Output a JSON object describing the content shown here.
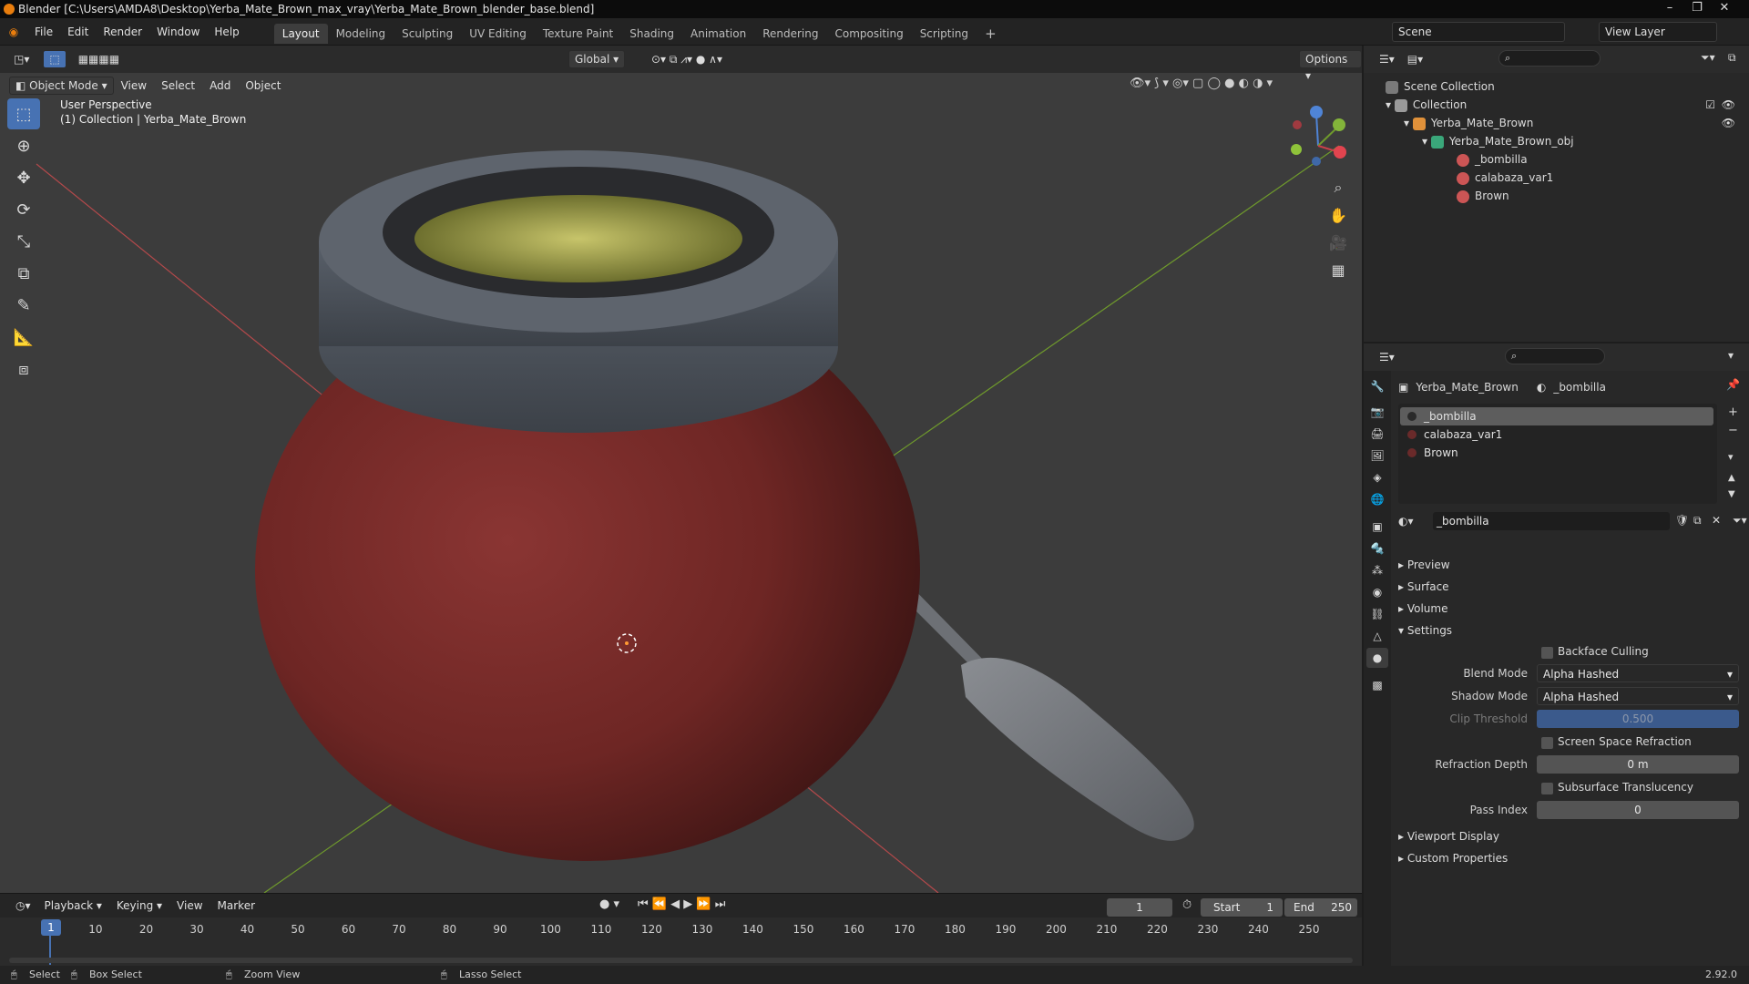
{
  "titlebar": {
    "title": "Blender [C:\\Users\\AMDA8\\Desktop\\Yerba_Mate_Brown_max_vray\\Yerba_Mate_Brown_blender_base.blend]"
  },
  "menu": [
    "File",
    "Edit",
    "Render",
    "Window",
    "Help"
  ],
  "workspaces": [
    "Layout",
    "Modeling",
    "Sculpting",
    "UV Editing",
    "Texture Paint",
    "Shading",
    "Animation",
    "Rendering",
    "Compositing",
    "Scripting"
  ],
  "scene": {
    "scene_name": "Scene",
    "view_layer": "View Layer"
  },
  "viewport": {
    "transform": "Global",
    "options": "Options",
    "mode": "Object Mode",
    "header_menus": [
      "View",
      "Select",
      "Add",
      "Object"
    ],
    "perspective": "User Perspective",
    "collection_info": "(1) Collection | Yerba_Mate_Brown",
    "gizmo": {
      "z": "Z",
      "y": "Y",
      "x": "X"
    }
  },
  "outliner": {
    "rows": [
      {
        "label": "Scene Collection"
      },
      {
        "label": "Collection"
      },
      {
        "label": "Yerba_Mate_Brown"
      },
      {
        "label": "Yerba_Mate_Brown_obj"
      },
      {
        "label": "_bombilla"
      },
      {
        "label": "calabaza_var1"
      },
      {
        "label": "Brown"
      }
    ]
  },
  "properties": {
    "object_name": "Yerba_Mate_Brown",
    "material_name": "_bombilla",
    "slots": [
      "_bombilla",
      "calabaza_var1",
      "Brown"
    ],
    "active_material": "_bombilla",
    "sections": {
      "preview": "Preview",
      "surface": "Surface",
      "volume": "Volume",
      "settings": "Settings",
      "viewport_display": "Viewport Display",
      "custom_properties": "Custom Properties"
    },
    "settings": {
      "backface_culling": "Backface Culling",
      "blend_mode_label": "Blend Mode",
      "blend_mode": "Alpha Hashed",
      "shadow_mode_label": "Shadow Mode",
      "shadow_mode": "Alpha Hashed",
      "clip_threshold_label": "Clip Threshold",
      "clip_threshold": "0.500",
      "ssr": "Screen Space Refraction",
      "refraction_depth_label": "Refraction Depth",
      "refraction_depth": "0 m",
      "subsurface": "Subsurface Translucency",
      "pass_index_label": "Pass Index",
      "pass_index": "0"
    }
  },
  "timeline": {
    "menus": [
      "Playback",
      "Keying",
      "View",
      "Marker"
    ],
    "current_frame": "1",
    "start_label": "Start",
    "start": "1",
    "end_label": "End",
    "end": "250",
    "ticks": [
      "1",
      "10",
      "20",
      "30",
      "40",
      "50",
      "60",
      "70",
      "80",
      "90",
      "100",
      "110",
      "120",
      "130",
      "140",
      "150",
      "160",
      "170",
      "180",
      "190",
      "200",
      "210",
      "220",
      "230",
      "240",
      "250"
    ]
  },
  "statusbar": {
    "select": "Select",
    "box_select": "Box Select",
    "zoom_view": "Zoom View",
    "lasso_select": "Lasso Select",
    "version": "2.92.0"
  },
  "colors": {
    "accent": "#4772b3",
    "gourd": "#7a2b2a",
    "rim": "#4b5158"
  }
}
